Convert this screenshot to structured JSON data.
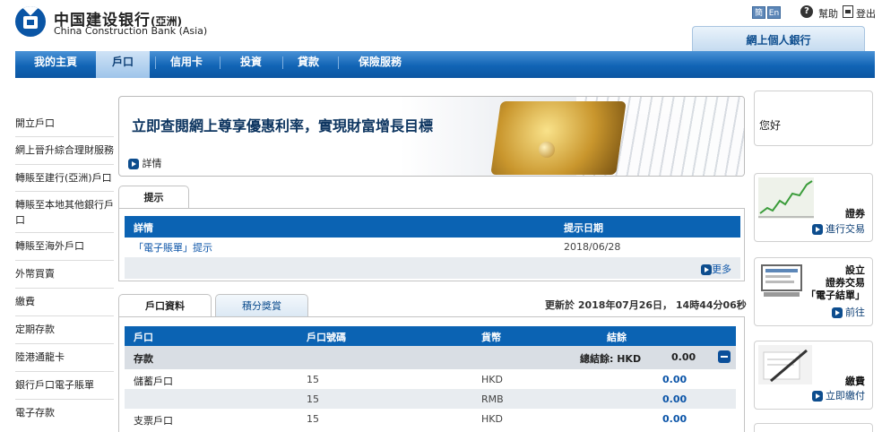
{
  "header": {
    "logo_cn": "中国建设银行",
    "logo_cn_suffix": "(亞洲)",
    "logo_en": "China Construction Bank (Asia)",
    "lang_simplified": "簡",
    "lang_english": "En",
    "help_label": "幫助",
    "logout_label": "登出",
    "ebank_tab": "網上個人銀行"
  },
  "nav": {
    "items": [
      {
        "label": "我的主頁"
      },
      {
        "label": "戶口"
      },
      {
        "label": "信用卡"
      },
      {
        "label": "投資"
      },
      {
        "label": "貸款"
      },
      {
        "label": "保險服務"
      }
    ]
  },
  "sidebar": {
    "items": [
      {
        "label": "開立戶口"
      },
      {
        "label": "網上晉升綜合理財服務"
      },
      {
        "label": "轉賬至建行(亞洲)戶口"
      },
      {
        "label": "轉賬至本地其他銀行戶口"
      },
      {
        "label": "轉賬至海外戶口"
      },
      {
        "label": "外幣買賣"
      },
      {
        "label": "繳費"
      },
      {
        "label": "定期存款"
      },
      {
        "label": "陸港通龍卡"
      },
      {
        "label": "銀行戶口電子賬單"
      },
      {
        "label": "電子存款"
      }
    ]
  },
  "banner": {
    "title": "立即查閱網上尊享優惠利率，實現財富增長目標",
    "link": "詳情"
  },
  "notices": {
    "tab": "提示",
    "col_details": "詳情",
    "col_date": "提示日期",
    "rows": [
      {
        "text": "「電子賬單」提示",
        "date": "2018/06/28"
      }
    ],
    "more": "更多"
  },
  "accounts": {
    "tab_active": "戶口資料",
    "tab_inactive": "積分獎賞",
    "updated": "更新於 2018年07月26日， 14時44分06秒",
    "headers": {
      "account": "戶口",
      "number": "戶口號碼",
      "currency": "貨幣",
      "balance": "結餘"
    },
    "section": {
      "label": "存款",
      "total_label": "總結餘: HKD",
      "total": "0.00"
    },
    "rows": [
      {
        "account": "儲蓄戶口",
        "number": "15",
        "currency": "HKD",
        "balance": "0.00"
      },
      {
        "account": "",
        "number": "15",
        "currency": "RMB",
        "balance": "0.00"
      },
      {
        "account": "支票戶口",
        "number": "15",
        "currency": "HKD",
        "balance": "0.00"
      }
    ]
  },
  "right": {
    "greeting": "您好",
    "securities_title": "證券",
    "securities_link": "進行交易",
    "estatement_title_1": "設立",
    "estatement_title_2": "證券交易",
    "estatement_title_3": "「電子結單」",
    "estatement_link": "前往",
    "bill_title": "繳費",
    "bill_link": "立即繳付"
  },
  "colors": {
    "brand_blue": "#0b63b3",
    "nav_blue": "#1164b5",
    "accent_value": "#0c55a8"
  }
}
